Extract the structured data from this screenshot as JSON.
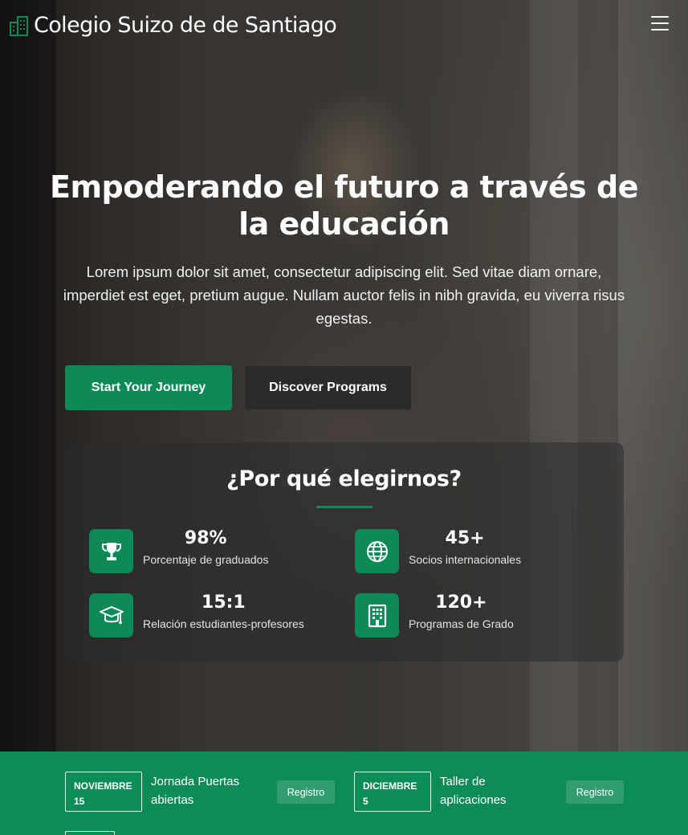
{
  "navbar": {
    "brand": "Colegio Suizo de de Santiago",
    "brand_icon": "building-icon",
    "menu_icon": "hamburger-menu-icon"
  },
  "hero": {
    "title": "Empoderando el futuro a través de la educación",
    "text": "Lorem ipsum dolor sit amet, consectetur adipiscing elit. Sed vitae diam ornare, imperdiet est eget, pretium augue. Nullam auctor felis in nibh gravida, eu viverra risus egestas.",
    "primary_button": "Start Your Journey",
    "secondary_button": "Discover Programs"
  },
  "why": {
    "title": "¿Por qué elegirnos?",
    "stats": [
      {
        "value": "98%",
        "label": "Porcentaje de graduados",
        "icon": "trophy-icon"
      },
      {
        "value": "45+",
        "label": "Socios internacionales",
        "icon": "globe-icon"
      },
      {
        "value": "15:1",
        "label": "Relación estudiantes-profesores",
        "icon": "graduation-cap-icon"
      },
      {
        "value": "120+",
        "label": "Programas de Grado",
        "icon": "building-icon"
      }
    ]
  },
  "events": [
    {
      "month": "NOVIEMBRE",
      "day": "15",
      "title": "Jornada Puertas abiertas",
      "button": "Registro"
    },
    {
      "month": "DICIEMBRE",
      "day": "5",
      "title": "Taller de aplicaciones",
      "button": "Registro"
    }
  ],
  "colors": {
    "accent": "#0e8a58",
    "secondary_button": "#2b2b2b"
  }
}
